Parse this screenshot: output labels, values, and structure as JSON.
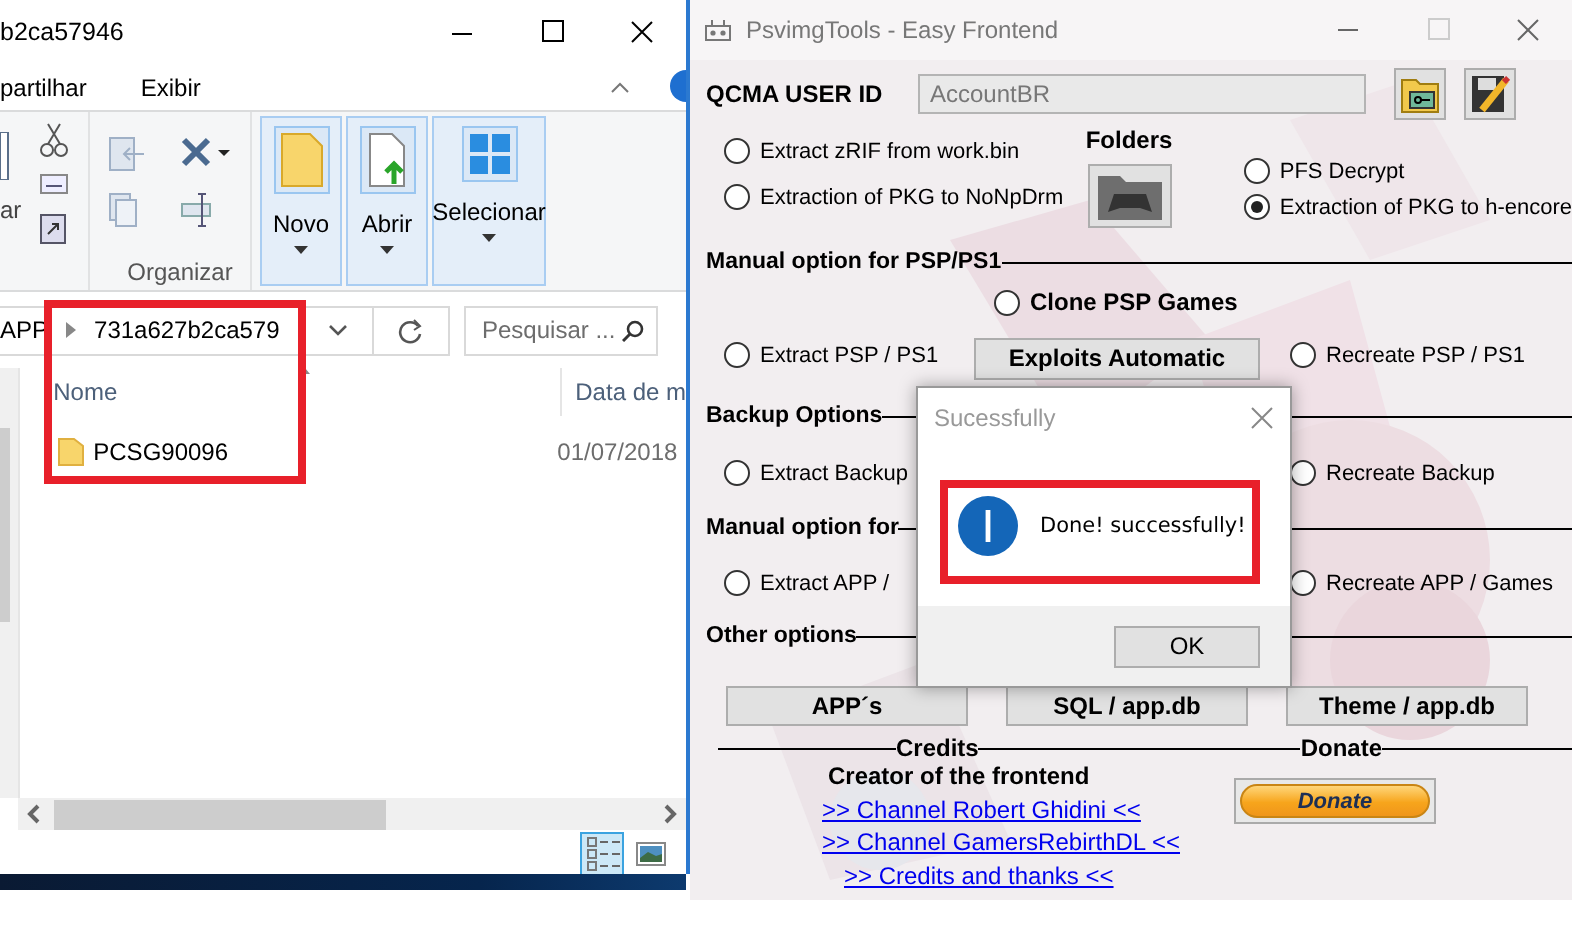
{
  "explorer": {
    "title": "b2ca57946",
    "ribbon_tabs": [
      "partilhar",
      "Exibir"
    ],
    "ribbon": {
      "clipped_label": "ar",
      "organize_label": "Organizar",
      "big_buttons": [
        {
          "kind": "folder",
          "label": "Novo"
        },
        {
          "kind": "open",
          "label": "Abrir"
        },
        {
          "kind": "select",
          "label": "Selecionar"
        }
      ]
    },
    "breadcrumb": [
      "APP",
      "731a627b2ca579"
    ],
    "search": {
      "placeholder": "Pesquisar ..."
    },
    "columns": [
      "Nome",
      "Data de m"
    ],
    "rows": [
      {
        "name": "PCSG90096",
        "date": "01/07/2018"
      }
    ],
    "view_buttons": [
      {
        "kind": "details",
        "selected": true
      },
      {
        "kind": "preview",
        "selected": false
      }
    ]
  },
  "app": {
    "title": "PsvimgTools - Easy Frontend",
    "user_id": {
      "label": "QCMA USER ID",
      "value": "AccountBR"
    },
    "folders_label": "Folders",
    "radios_left": [
      {
        "label": "Extract zRIF from work.bin",
        "selected": false
      },
      {
        "label": "Extraction of PKG to NoNpDrm",
        "selected": false
      }
    ],
    "radios_right": [
      {
        "label": "PFS Decrypt",
        "selected": false
      },
      {
        "label": "Extraction of PKG to h-encore",
        "selected": true
      }
    ],
    "psp": {
      "heading": "Manual option for PSP/PS1",
      "clone": {
        "label": "Clone PSP Games",
        "selected": false
      },
      "extract": {
        "label": "Extract PSP / PS1",
        "selected": false
      },
      "button": "Exploits Automatic",
      "recreate": {
        "label": "Recreate PSP / PS1",
        "selected": false
      }
    },
    "backup": {
      "heading": "Backup Options",
      "extract": {
        "label": "Extract Backup",
        "selected": false
      },
      "recreate": {
        "label": "Recreate Backup",
        "selected": false
      }
    },
    "apps": {
      "heading": "Manual option for",
      "extract": {
        "label": "Extract APP /",
        "selected": false
      },
      "recreate": {
        "label": "Recreate APP / Games",
        "selected": false
      }
    },
    "other": {
      "heading": "Other options",
      "buttons": [
        "APP´s",
        "SQL / app.db",
        "Theme / app.db"
      ]
    },
    "credits": {
      "heading": "Credits",
      "creator": "Creator of the frontend",
      "links": [
        ">> Channel Robert Ghidini <<",
        ">> Channel GamersRebirthDL <<",
        ">> Credits and thanks <<"
      ]
    },
    "donate": {
      "heading": "Donate",
      "button": "Donate"
    }
  },
  "dialog": {
    "title": "Sucessfully",
    "message": "Done! successfully!",
    "button": "OK"
  }
}
